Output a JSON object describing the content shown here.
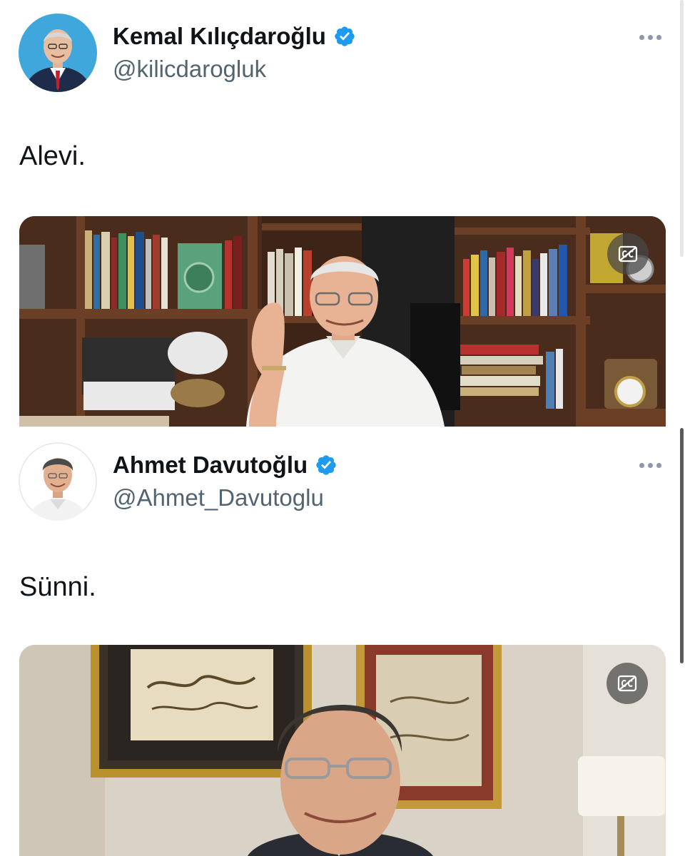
{
  "tweets": [
    {
      "display_name": "Kemal Kılıçdaroğlu",
      "handle": "@kilicdarogluk",
      "text": "Alevi.",
      "verified": true,
      "avatar_bg": "#3fa7dc"
    },
    {
      "display_name": "Ahmet Davutoğlu",
      "handle": "@Ahmet_Davutoglu",
      "text": "Sünni.",
      "verified": true,
      "avatar_bg": "#ffffff"
    }
  ],
  "icons": {
    "verified": "verified-badge-icon",
    "more": "more-options-icon",
    "captions": "closed-captions-icon"
  },
  "colors": {
    "verified_blue": "#1d9bf0",
    "handle_gray": "#536471",
    "text": "#0f1419"
  }
}
